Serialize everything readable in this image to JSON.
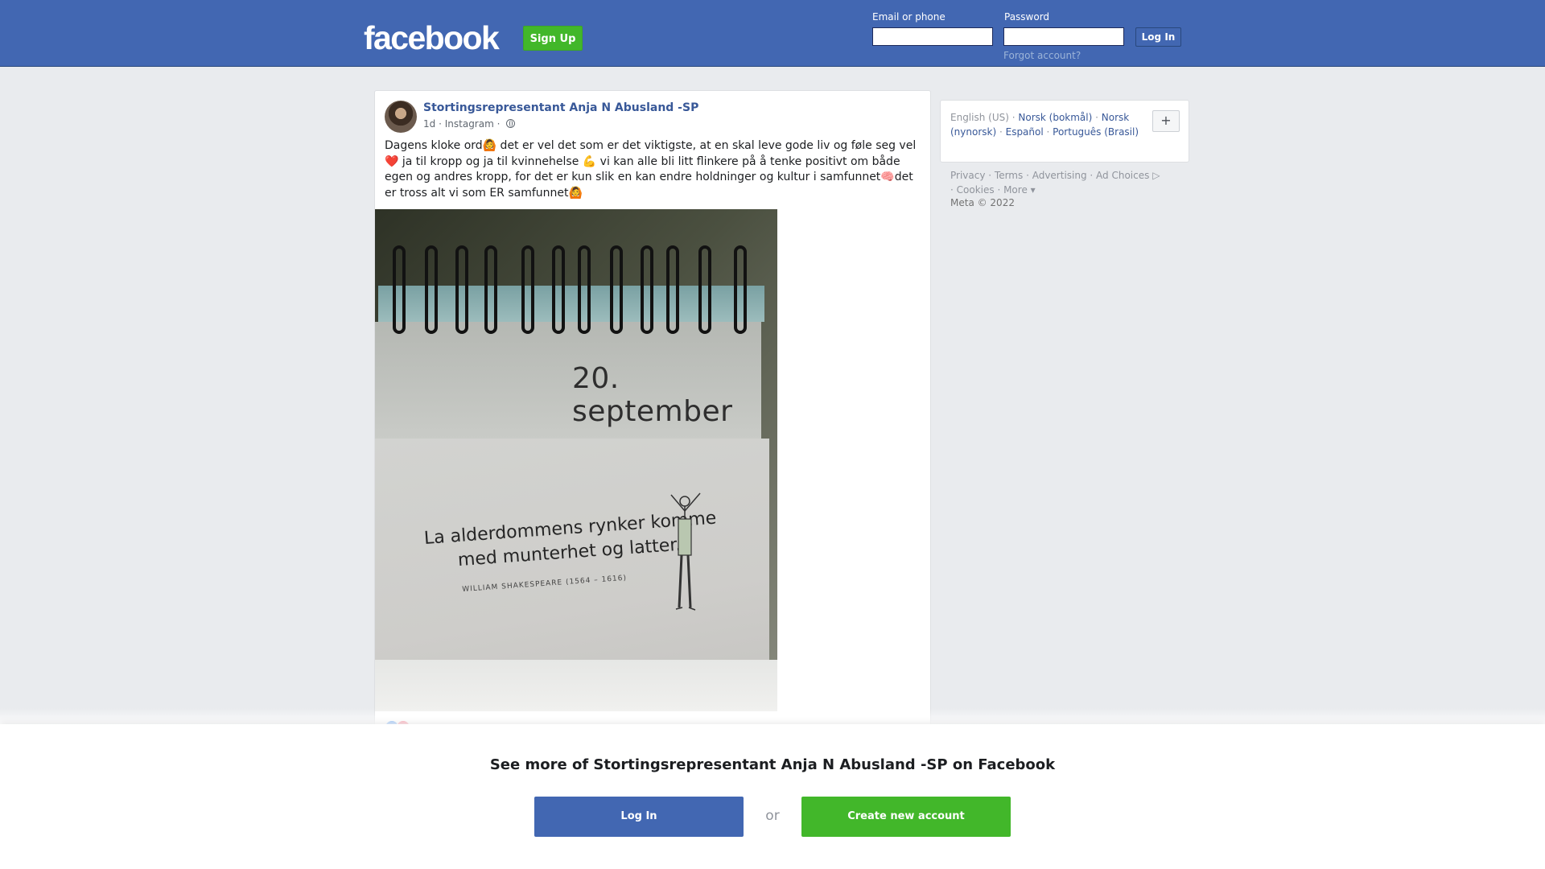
{
  "header": {
    "logo": "facebook",
    "signup_label": "Sign Up",
    "email_label": "Email or phone",
    "password_label": "Password",
    "login_label": "Log In",
    "forgot_label": "Forgot account?"
  },
  "post": {
    "author": "Stortingsrepresentant Anja N Abusland -SP",
    "time": "1d",
    "source": "Instagram",
    "audience_icon": "globe-icon",
    "text_lines": [
      "Dagens kloke ord🙆 det er vel det som er det viktigste, at en skal leve gode liv og føle seg vel",
      "❤️ ja til kropp og ja til kvinnehelse 💪 vi kan alle bli litt flinkere på å tenke positivt om både",
      "egen og andres kropp, for det er kun slik en kan endre holdninger og kultur i samfunnet🧠det",
      "er tross alt vi som ER samfunnet🙆"
    ],
    "image": {
      "date": "20. september",
      "quote_line1": "La alderdommens rynker komme",
      "quote_line2": "med munterhet og latter.",
      "attribution": "WILLIAM SHAKESPEARE (1564 – 1616)"
    }
  },
  "sidebar": {
    "languages": {
      "current": "English (US)",
      "options": [
        "Norsk (bokmål)",
        "Norsk (nynorsk)",
        "Español",
        "Português (Brasil)"
      ],
      "more_icon": "plus-icon"
    },
    "footer_links": [
      "Privacy",
      "Terms",
      "Advertising",
      "Ad Choices",
      "Cookies",
      "More"
    ],
    "copyright": "Meta © 2022"
  },
  "bottom_sheet": {
    "title": "See more of Stortingsrepresentant Anja N Abusland -SP on Facebook",
    "login_label": "Log In",
    "or_label": "or",
    "create_label": "Create new account"
  },
  "colors": {
    "brand": "#4267b2",
    "green": "#42b72a",
    "link": "#385898",
    "background": "#e9ebee"
  }
}
